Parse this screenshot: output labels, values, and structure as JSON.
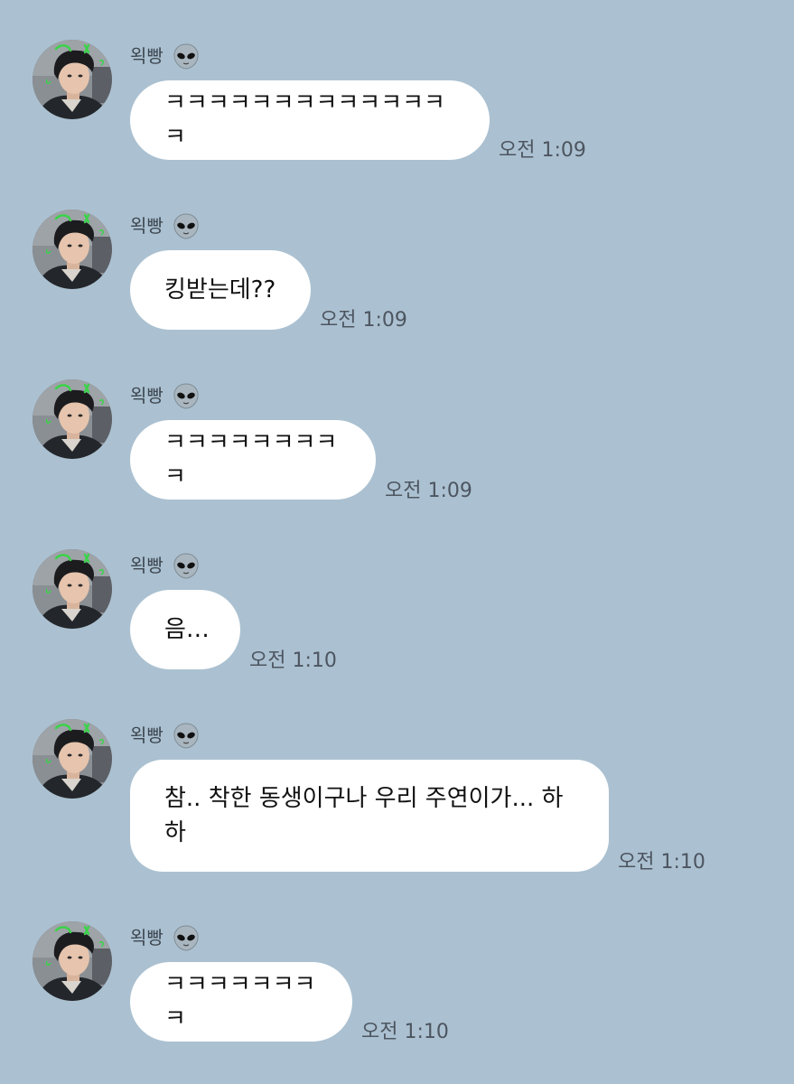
{
  "sender": {
    "name": "왹빵",
    "avatar_icon": "profile-photo",
    "badge_icon": "alien-icon"
  },
  "messages": [
    {
      "text": "ㅋㅋㅋㅋㅋㅋㅋㅋㅋㅋㅋㅋㅋㅋ",
      "time": "오전 1:09"
    },
    {
      "text": "킹받는데??",
      "time": "오전 1:09"
    },
    {
      "text": "ㅋㅋㅋㅋㅋㅋㅋㅋㅋ",
      "time": "오전 1:09"
    },
    {
      "text": "음…",
      "time": "오전 1:10"
    },
    {
      "text": "참.. 착한 동생이구나 우리 주연이가... 하\n하",
      "time": "오전 1:10"
    },
    {
      "text": "ㅋㅋㅋㅋㅋㅋㅋㅋ",
      "time": "오전 1:10"
    }
  ],
  "colors": {
    "background": "#abc1d1",
    "bubble": "#ffffff",
    "text": "#111111",
    "timestamp": "#4d5560"
  }
}
